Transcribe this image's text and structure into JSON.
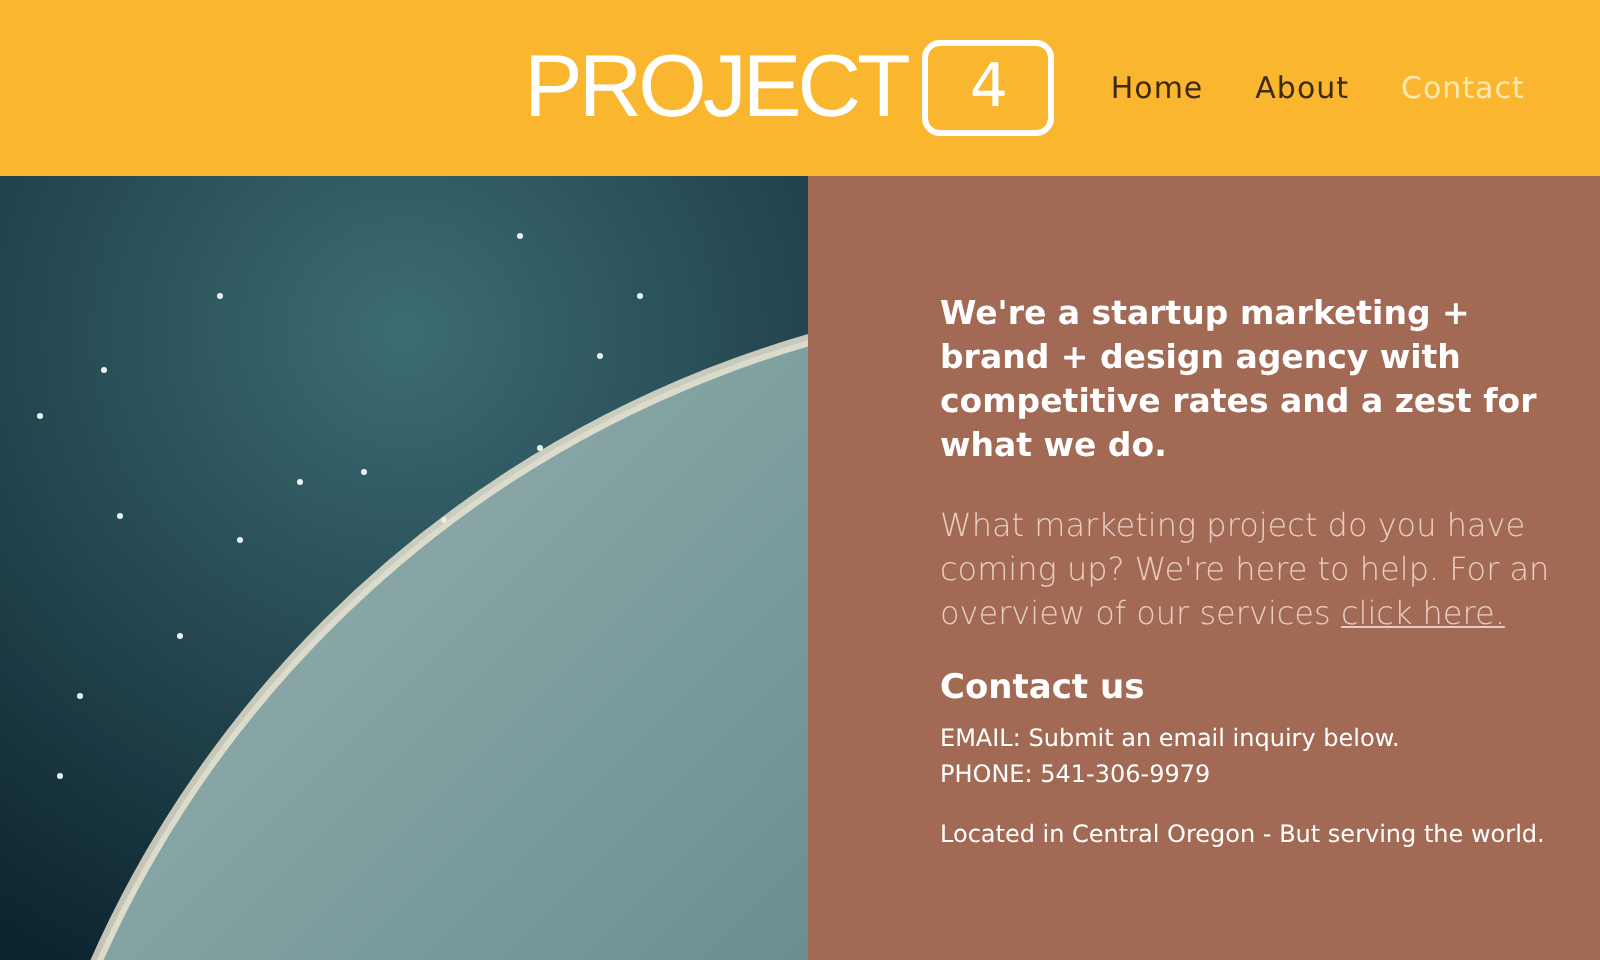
{
  "header": {
    "logo": {
      "word": "PROJECT",
      "number": "4"
    },
    "nav": [
      {
        "label": "Home",
        "selected": false
      },
      {
        "label": "About",
        "selected": false
      },
      {
        "label": "Contact",
        "selected": true
      }
    ]
  },
  "intro": {
    "headline": "We're a startup marketing + brand + design agency with competitive rates and a zest for what we do.",
    "paragraph": "What marketing project do you have coming up? We're here to help. For an overview of our services ",
    "link": "click here."
  },
  "contact": {
    "heading": "Contact us",
    "email": "EMAIL: Submit an email inquiry below.",
    "phone": "PHONE: 541-306-9979",
    "location": "Located in Central Oregon - But serving the world."
  }
}
